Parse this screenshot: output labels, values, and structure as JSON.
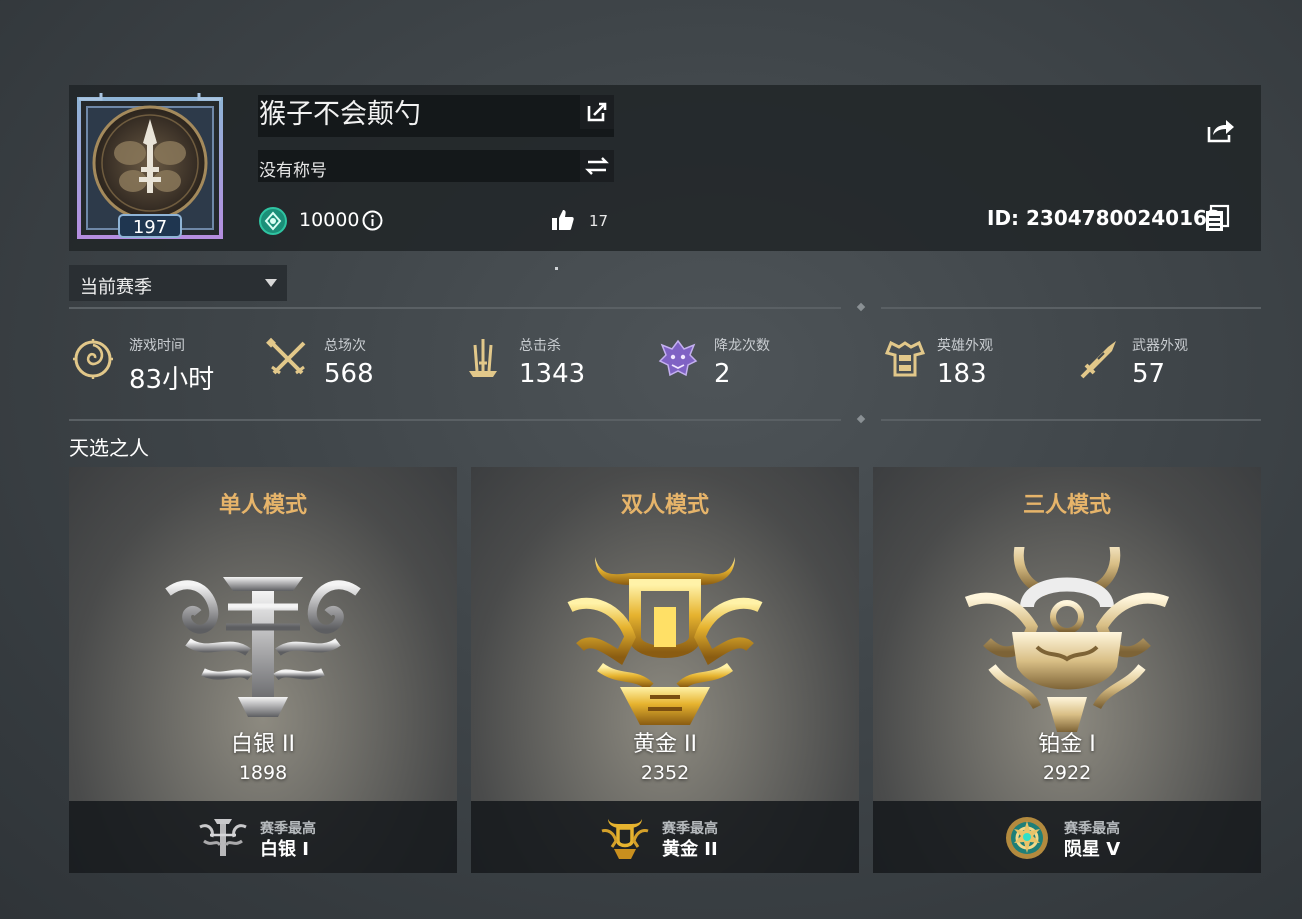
{
  "profile": {
    "level": "197",
    "name": "猴子不会颠勺",
    "title": "没有称号",
    "currency": "10000",
    "likes": "17",
    "id_text": "ID:  23047800240163"
  },
  "season": {
    "selected": "当前赛季"
  },
  "stats": [
    {
      "label": "游戏时间",
      "value": "83小时",
      "icon": "vortex-icon"
    },
    {
      "label": "总场次",
      "value": "568",
      "icon": "crossed-swords-icon"
    },
    {
      "label": "总击杀",
      "value": "1343",
      "icon": "sword-cluster-icon"
    },
    {
      "label": "降龙次数",
      "value": "2",
      "icon": "dragon-head-icon"
    },
    {
      "label": "英雄外观",
      "value": "183",
      "icon": "armor-icon"
    },
    {
      "label": "武器外观",
      "value": "57",
      "icon": "weapon-icon"
    }
  ],
  "section_title": "天选之人",
  "cards": [
    {
      "mode": "单人模式",
      "rank": "白银 II",
      "score": "1898",
      "best_label": "赛季最高",
      "best_rank": "白银 I",
      "tier": "silver"
    },
    {
      "mode": "双人模式",
      "rank": "黄金 II",
      "score": "2352",
      "best_label": "赛季最高",
      "best_rank": "黄金 II",
      "tier": "gold"
    },
    {
      "mode": "三人模式",
      "rank": "铂金 I",
      "score": "2922",
      "best_label": "赛季最高",
      "best_rank": "陨星 V",
      "tier": "platinum"
    }
  ],
  "colors": {
    "mode_title": "#e6b46a",
    "gold_icon": "#e2c88a",
    "coin": "#2fc4a2",
    "dragon": "#9b7ad6"
  }
}
